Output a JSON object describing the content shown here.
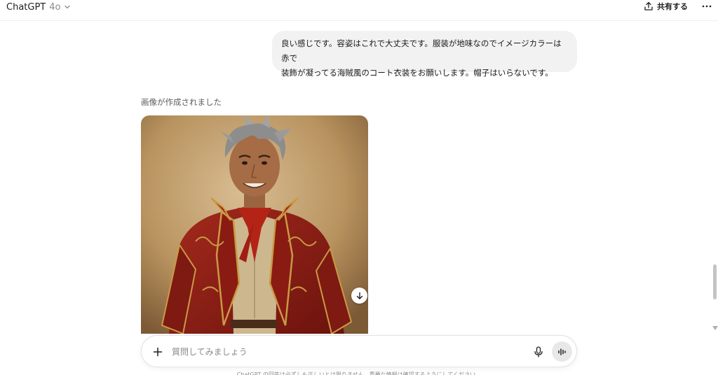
{
  "header": {
    "model_name": "ChatGPT",
    "model_version": "4o",
    "share_label": "共有する",
    "chevron_icon": "chevron-down-icon",
    "share_icon": "share-upload-icon",
    "more_icon": "more-horizontal-icon"
  },
  "conversation": {
    "user_message": "良い感じです。容姿はこれで大丈夫です。服装が地味なのでイメージカラーは赤で\n装飾が凝ってる海賊風のコート衣装をお願いします。帽子はいらないです。",
    "assistant_status": "画像が作成されました",
    "image_download_icon": "download-icon"
  },
  "composer": {
    "placeholder": "質問してみましょう",
    "value": "",
    "plus_icon": "plus-icon",
    "mic_icon": "microphone-icon",
    "voice_icon": "voice-mode-icon"
  },
  "footer": {
    "disclaimer": "ChatGPT の回答は必ずしも正しいとは限りません。重要な情報は確認するようにしてください。"
  },
  "colors": {
    "bubble_bg": "#f2f2f2",
    "coat_red": "#8e1c14",
    "gold_trim": "#c99a45",
    "backdrop": "#c9a77a"
  }
}
